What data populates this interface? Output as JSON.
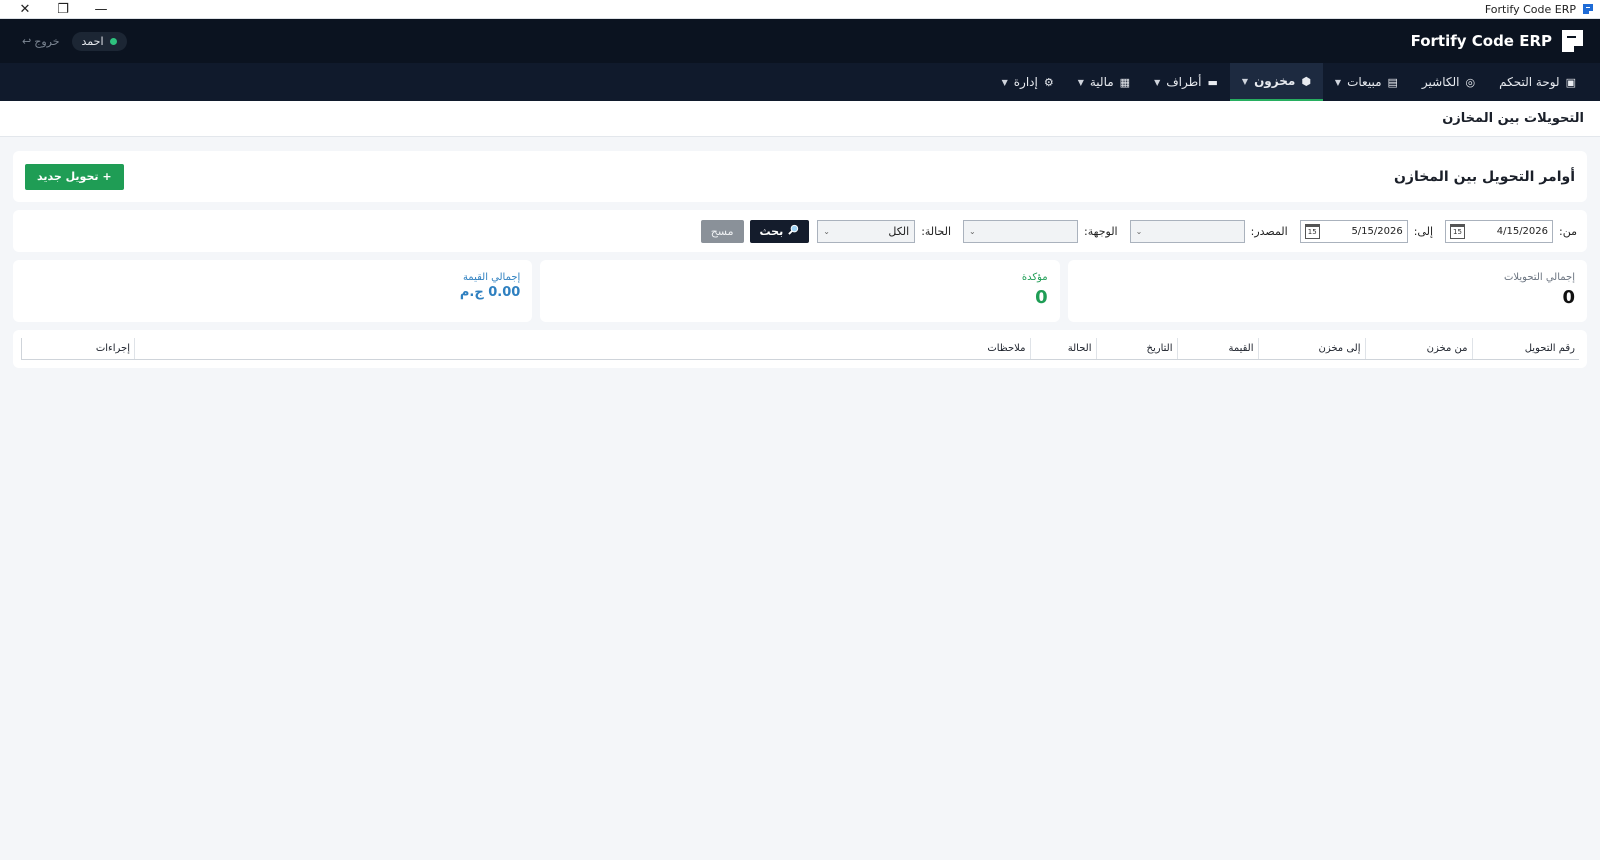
{
  "window": {
    "title": "Fortify Code ERP",
    "controls": {
      "close": "✕",
      "restore": "❐",
      "minimize": "—"
    }
  },
  "header": {
    "brand": "Fortify Code ERP",
    "user_name": "احمد",
    "logout_label": "خروج",
    "logout_icon": "↩"
  },
  "nav": {
    "items": [
      {
        "label": "لوحة التحكم",
        "icon": "dashboard-icon",
        "has_menu": false,
        "active": false
      },
      {
        "label": "الكاشير",
        "icon": "cashier-icon",
        "has_menu": false,
        "active": false
      },
      {
        "label": "مبيعات",
        "icon": "receipt-icon",
        "has_menu": true,
        "active": false
      },
      {
        "label": "مخزون",
        "icon": "box-icon",
        "has_menu": true,
        "active": true
      },
      {
        "label": "أطراف",
        "icon": "people-icon",
        "has_menu": true,
        "active": false
      },
      {
        "label": "مالية",
        "icon": "calculator-icon",
        "has_menu": true,
        "active": false
      },
      {
        "label": "إدارة",
        "icon": "gear-icon",
        "has_menu": true,
        "active": false
      }
    ],
    "accent": "#27ae60"
  },
  "page": {
    "title": "التحويلات بين المخازن",
    "section_title": "أوامر التحويل بين المخازن",
    "new_button": "+ تحويل جديد"
  },
  "filters": {
    "from_label": "من:",
    "from_value": "4/15/2026",
    "to_label": "إلى:",
    "to_value": "5/15/2026",
    "source_label": "المصدر:",
    "source_value": "",
    "destination_label": "الوجهة:",
    "destination_value": "",
    "status_label": "الحالة:",
    "status_value": "الكل",
    "search_button": "بحث",
    "clear_button": "مسح",
    "calendar_day": "15"
  },
  "stats": {
    "total_label": "إجمالي التحويلات",
    "total_value": "0",
    "confirmed_label": "مؤكدة",
    "confirmed_value": "0",
    "value_label": "إجمالي القيمة",
    "value_value": "0.00 ج.م"
  },
  "table": {
    "columns": [
      "رقم التحويل",
      "من مخزن",
      "إلى مخزن",
      "القيمة",
      "التاريخ",
      "الحالة",
      "ملاحظات",
      "إجراءات"
    ],
    "rows": []
  },
  "colors": {
    "header_bg": "#0b1320",
    "nav_bg": "#101a2c",
    "primary_green": "#1f9d55",
    "value_blue": "#2f80c0"
  }
}
